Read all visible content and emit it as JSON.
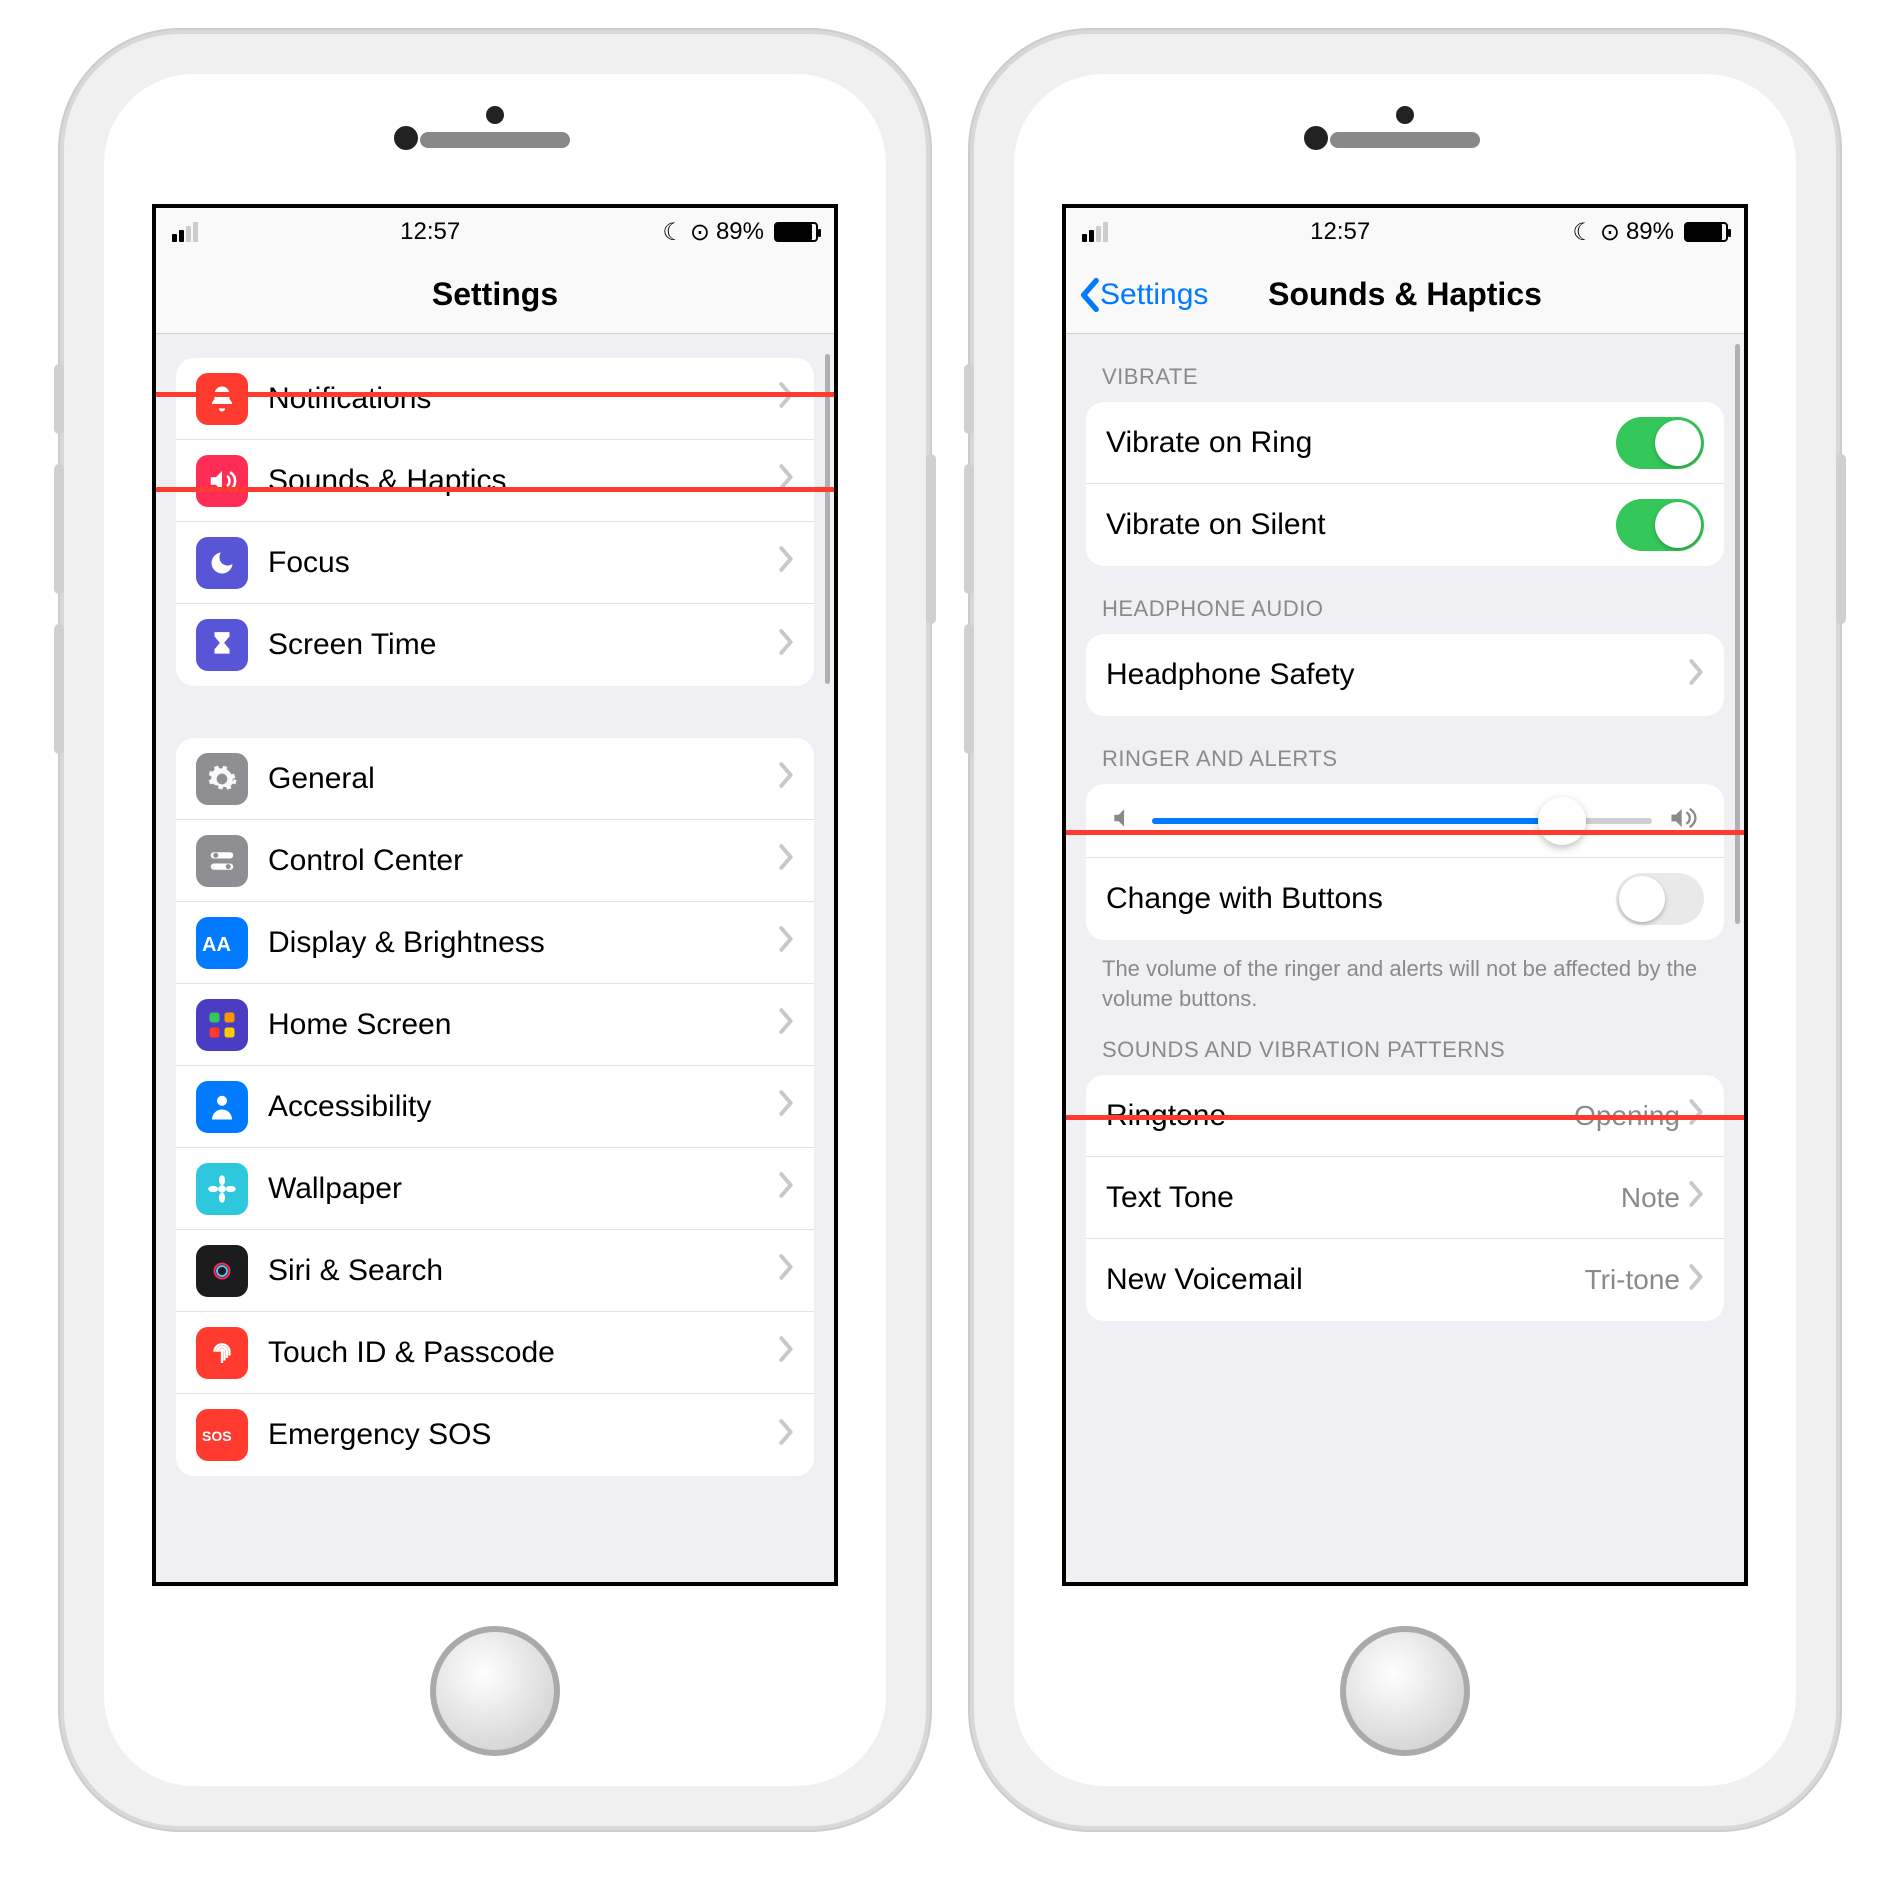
{
  "status": {
    "time": "12:57",
    "battery_pct": "89%",
    "moon": "☾",
    "lock": "⊙"
  },
  "phone1": {
    "nav_title": "Settings",
    "sections": {
      "a": [
        {
          "icon": "bell-icon",
          "bg": "#ff3b30",
          "label": "Notifications"
        },
        {
          "icon": "speaker-icon",
          "bg": "#ff2d55",
          "label": "Sounds & Haptics"
        },
        {
          "icon": "moon-icon",
          "bg": "#5856d6",
          "label": "Focus"
        },
        {
          "icon": "hourglass-icon",
          "bg": "#5856d6",
          "label": "Screen Time"
        }
      ],
      "b": [
        {
          "icon": "gear-icon",
          "bg": "#8e8e93",
          "label": "General"
        },
        {
          "icon": "switches-icon",
          "bg": "#8e8e93",
          "label": "Control Center"
        },
        {
          "icon": "aa-icon",
          "bg": "#007aff",
          "label": "Display & Brightness"
        },
        {
          "icon": "grid-icon",
          "bg": "#4b3cc4",
          "label": "Home Screen"
        },
        {
          "icon": "person-icon",
          "bg": "#007aff",
          "label": "Accessibility"
        },
        {
          "icon": "flower-icon",
          "bg": "#2ec8de",
          "label": "Wallpaper"
        },
        {
          "icon": "siri-icon",
          "bg": "#1c1c1e",
          "label": "Siri & Search"
        },
        {
          "icon": "fingerprint-icon",
          "bg": "#ff3b30",
          "label": "Touch ID & Passcode"
        },
        {
          "icon": "sos-icon",
          "bg": "#ff3b30",
          "label": "Emergency SOS"
        }
      ]
    }
  },
  "phone2": {
    "back_label": "Settings",
    "nav_title": "Sounds & Haptics",
    "headers": {
      "vibrate": "VIBRATE",
      "headphone": "HEADPHONE AUDIO",
      "ringer": "RINGER AND ALERTS",
      "patterns": "SOUNDS AND VIBRATION PATTERNS"
    },
    "vibrate": {
      "ring": "Vibrate on Ring",
      "silent": "Vibrate on Silent"
    },
    "headphone_safety": "Headphone Safety",
    "change_buttons": "Change with Buttons",
    "footer": "The volume of the ringer and alerts will not be affected by the volume buttons.",
    "patterns": [
      {
        "label": "Ringtone",
        "value": "Opening"
      },
      {
        "label": "Text Tone",
        "value": "Note"
      },
      {
        "label": "New Voicemail",
        "value": "Tri-tone"
      }
    ],
    "slider_pct": 82
  }
}
